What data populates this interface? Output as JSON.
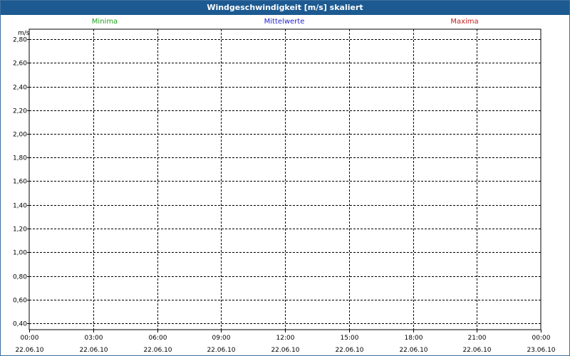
{
  "window": {
    "title": "Windgeschwindigkeit [m/s] skaliert"
  },
  "legend": [
    {
      "label": "Minima",
      "color": "#1fa31f"
    },
    {
      "label": "Mittelwerte",
      "color": "#1f1fcf"
    },
    {
      "label": "Maxima",
      "color": "#c41f1f"
    }
  ],
  "chart_data": {
    "type": "line",
    "title": "Windgeschwindigkeit [m/s] skaliert",
    "ylabel": "m/s",
    "xlabel": "",
    "ylim": [
      0.4,
      2.8
    ],
    "yticks": [
      "2,80",
      "2,60",
      "2,40",
      "2,20",
      "2,00",
      "1,80",
      "1,60",
      "1,40",
      "1,20",
      "1,00",
      "0,80",
      "0,60",
      "0,40"
    ],
    "yticks_values": [
      2.8,
      2.6,
      2.4,
      2.2,
      2.0,
      1.8,
      1.6,
      1.4,
      1.2,
      1.0,
      0.8,
      0.6,
      0.4
    ],
    "xticks": [
      {
        "time": "00:00",
        "date": "22.06.10"
      },
      {
        "time": "03:00",
        "date": "22.06.10"
      },
      {
        "time": "06:00",
        "date": "22.06.10"
      },
      {
        "time": "09:00",
        "date": "22.06.10"
      },
      {
        "time": "12:00",
        "date": "22.06.10"
      },
      {
        "time": "15:00",
        "date": "22.06.10"
      },
      {
        "time": "18:00",
        "date": "22.06.10"
      },
      {
        "time": "21:00",
        "date": "22.06.10"
      },
      {
        "time": "00:00",
        "date": "23.06.10"
      }
    ],
    "series": [
      {
        "name": "Minima",
        "values": []
      },
      {
        "name": "Mittelwerte",
        "values": []
      },
      {
        "name": "Maxima",
        "values": []
      }
    ],
    "grid": true
  }
}
